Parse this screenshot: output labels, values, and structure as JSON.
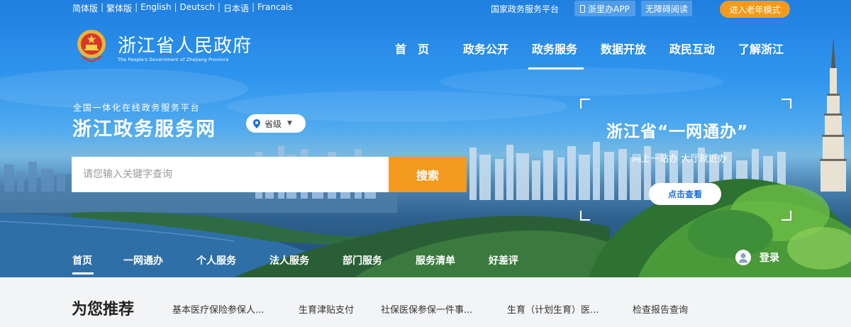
{
  "top_bar": {
    "languages": [
      "简体版",
      "繁体版",
      "English",
      "Deutsch",
      "日本语",
      "Francais"
    ],
    "separator": "|",
    "national_platform": "国家政务服务平台",
    "app_link": "浙里办APP",
    "accessible_reading": "无障碍阅读",
    "elder_mode": "进入老年模式"
  },
  "logo": {
    "title": "浙江省人民政府",
    "subtitle": "The People's Government of Zhejiang Province"
  },
  "main_nav": {
    "items": [
      "首　页",
      "政务公开",
      "政务服务",
      "数据开放",
      "政民互动",
      "了解浙江"
    ],
    "active": "政务服务"
  },
  "platform": {
    "subtitle": "全国一体化在线政务服务平台",
    "title": "浙江政务服务网",
    "region": "省级"
  },
  "search": {
    "placeholder": "请您输入关键字查询",
    "button": "搜索"
  },
  "one_network": {
    "title": "浙江省“一网通办”",
    "slogan": "网上一站办 大厅就近办",
    "button": "点击查看"
  },
  "tabs": {
    "items": [
      "首页",
      "一网通办",
      "个人服务",
      "法人服务",
      "部门服务",
      "服务清单",
      "好差评"
    ],
    "active": "首页",
    "login": "登录"
  },
  "recommend": {
    "title": "为您推荐",
    "items": [
      "基本医疗保险参保人...",
      "生育津贴支付",
      "社保医保参保一件事...",
      "生育（计划生育）医...",
      "检查报告查询"
    ]
  },
  "colors": {
    "accent_orange": "#f39a1e",
    "sky_blue": "#2f95ee",
    "strip_bg": "#f3f4f6"
  }
}
